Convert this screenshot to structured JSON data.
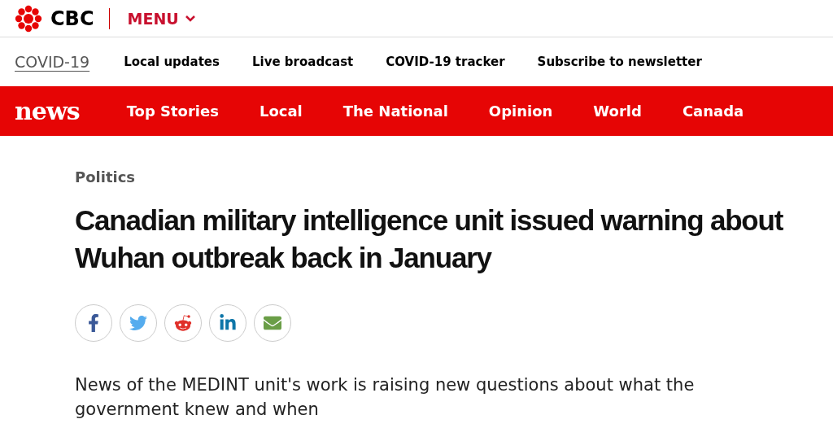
{
  "brand": {
    "name": "CBC",
    "menu": "MENU"
  },
  "covid_bar": {
    "title": "COVID-19",
    "links": [
      "Local updates",
      "Live broadcast",
      "COVID-19 tracker",
      "Subscribe to newsletter"
    ]
  },
  "news_nav": {
    "logo": "news",
    "items": [
      "Top Stories",
      "Local",
      "The National",
      "Opinion",
      "World",
      "Canada"
    ]
  },
  "article": {
    "section": "Politics",
    "headline": "Canadian military intelligence unit issued warning about Wuhan outbreak back in January",
    "share": [
      {
        "kind": "facebook"
      },
      {
        "kind": "twitter"
      },
      {
        "kind": "reddit"
      },
      {
        "kind": "linkedin"
      },
      {
        "kind": "email"
      }
    ],
    "deck": "News of the MEDINT unit's work is raising new questions about what the government knew and when"
  }
}
